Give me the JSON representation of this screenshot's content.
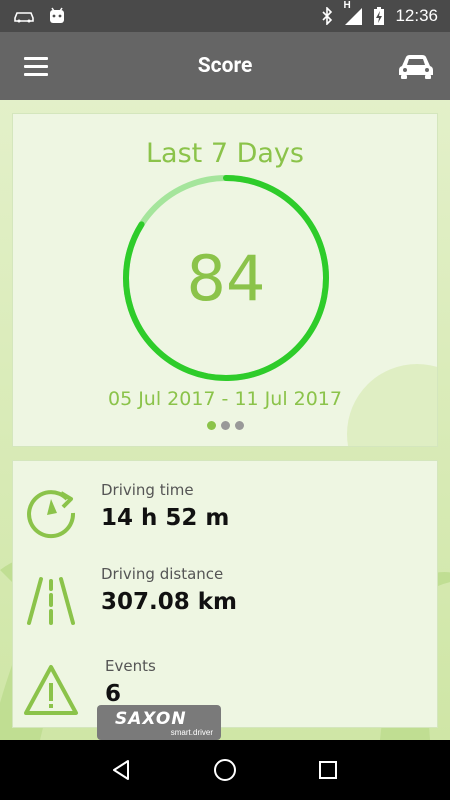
{
  "status_bar": {
    "time": "12:36",
    "network_label": "H"
  },
  "app_bar": {
    "title": "Score"
  },
  "score_card": {
    "title": "Last 7 Days",
    "score": "84",
    "score_fraction": 0.84,
    "date_range": "05 Jul 2017 - 11 Jul 2017",
    "page_indicator": {
      "count": 3,
      "active": 0
    },
    "colors": {
      "arc": "#2ecc2a",
      "arc_light": "#a5e59c",
      "accent": "#8bc34a"
    }
  },
  "stats": [
    {
      "label": "Driving time",
      "value": "14 h 52 m",
      "icon": "clock-arrow-icon"
    },
    {
      "label": "Driving distance",
      "value": "307.08 km",
      "icon": "road-icon"
    },
    {
      "label": "Events",
      "value": "6",
      "icon": "warning-icon"
    }
  ],
  "brand": {
    "name": "SAXON",
    "subtitle": "smart.driver"
  },
  "nav_bar": {
    "buttons": [
      "back-icon",
      "home-icon",
      "recents-icon"
    ]
  }
}
